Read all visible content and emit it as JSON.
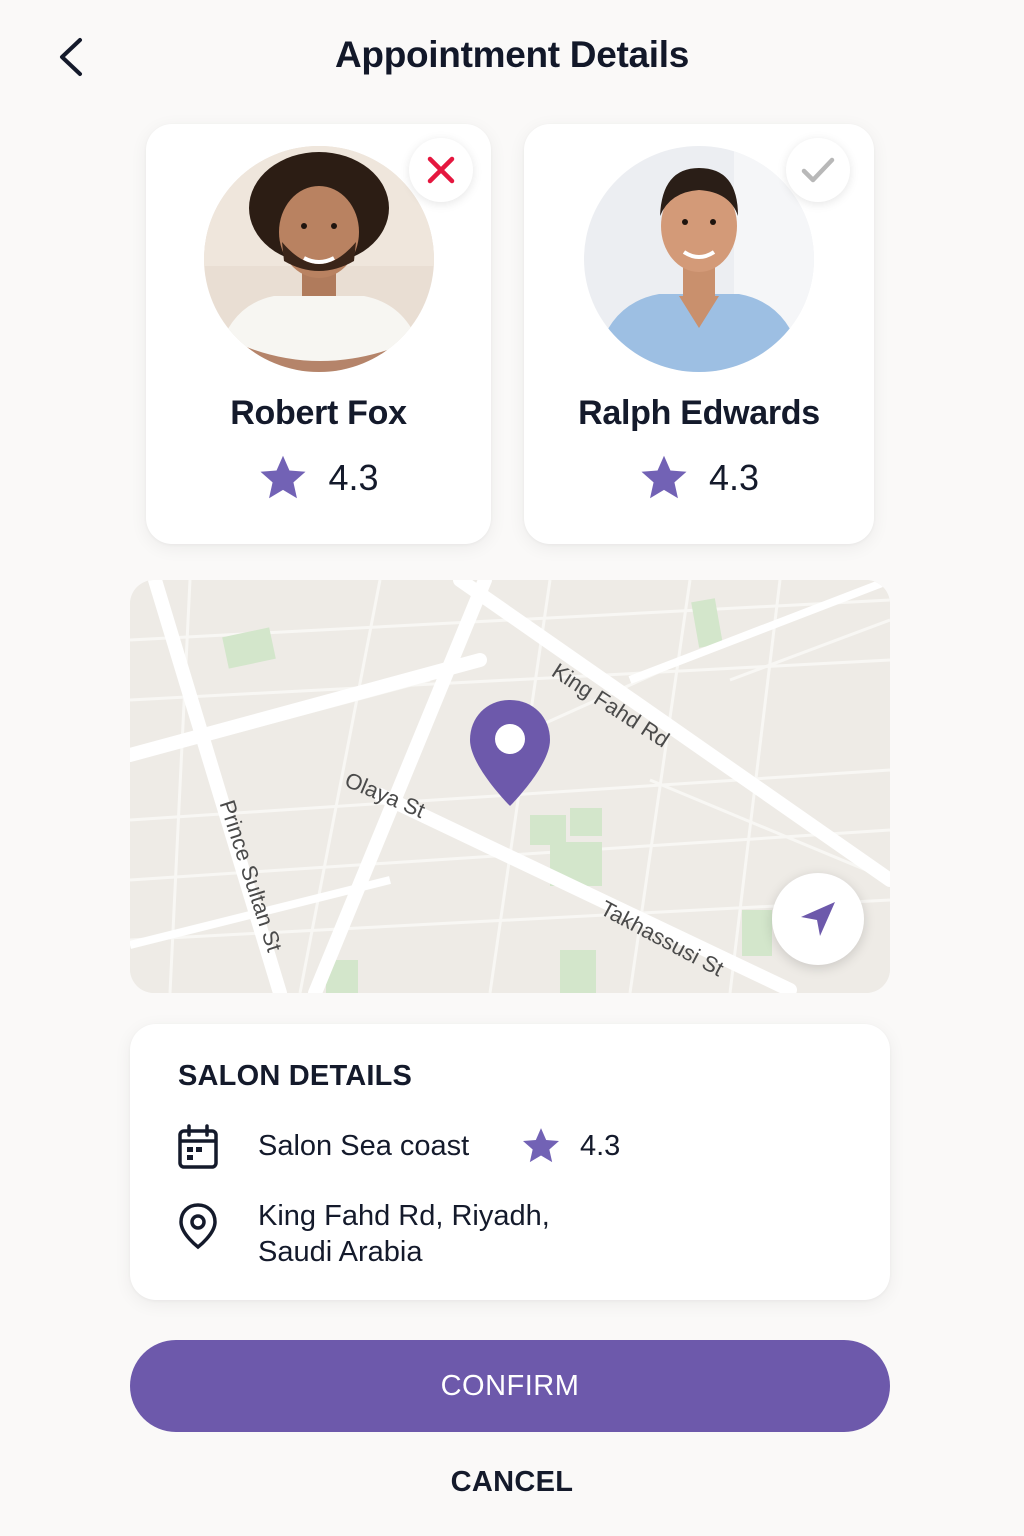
{
  "header": {
    "title": "Appointment Details",
    "back_icon": "chevron-left-icon"
  },
  "stylists": [
    {
      "name": "Robert Fox",
      "rating": "4.3",
      "status_icon": "close-icon",
      "status_color": "#e5173f"
    },
    {
      "name": "Ralph Edwards",
      "rating": "4.3",
      "status_icon": "check-icon",
      "status_color": "#b8b8b8"
    }
  ],
  "map": {
    "streets": [
      "King Fahd Rd",
      "Olaya St",
      "Prince Sultan St",
      "Takhassusi St"
    ],
    "pin_icon": "map-pin-icon",
    "locate_icon": "navigation-arrow-icon"
  },
  "salon": {
    "section_title": "SALON DETAILS",
    "name": "Salon Sea coast",
    "rating": "4.3",
    "address_line1": "King Fahd Rd, Riyadh,",
    "address_line2": "Saudi Arabia"
  },
  "actions": {
    "confirm_label": "CONFIRM",
    "cancel_label": "CANCEL"
  },
  "colors": {
    "accent": "#6d59ab",
    "star": "#7262b5",
    "text": "#141a2b",
    "background": "#faf9f8"
  }
}
